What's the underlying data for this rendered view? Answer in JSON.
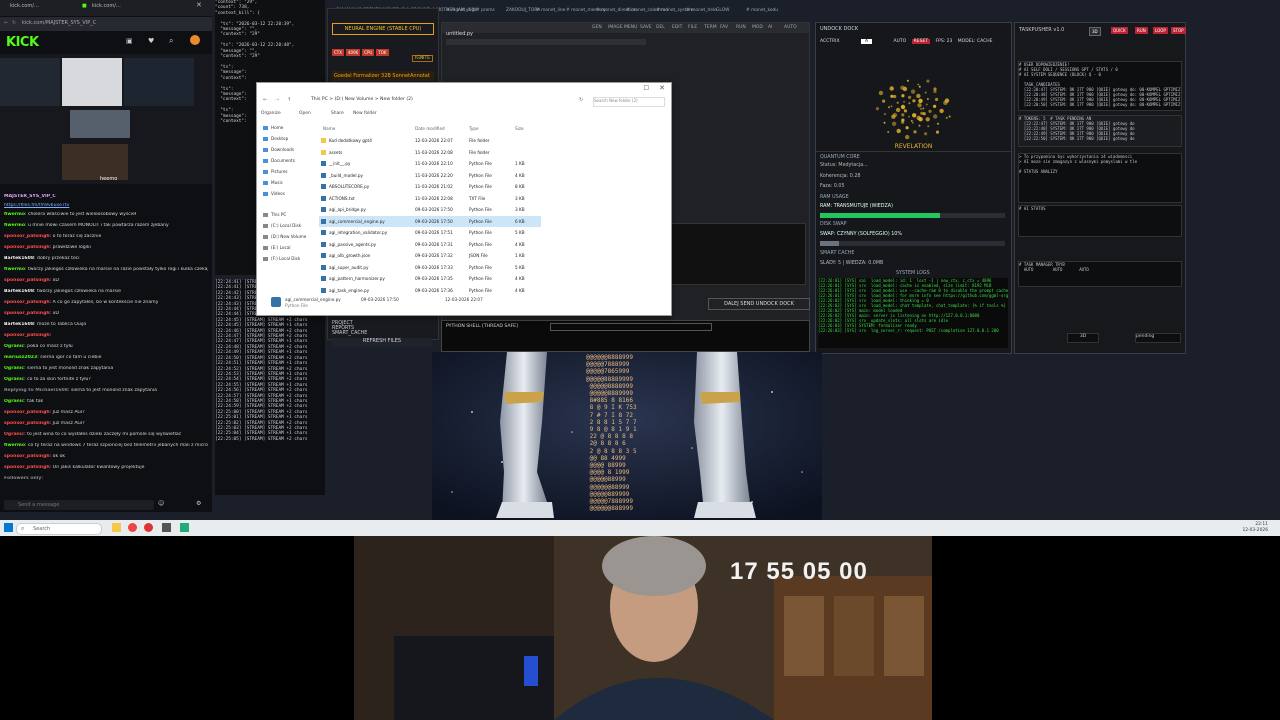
{
  "browser": {
    "tabs": [
      "kick.com/…",
      "Task System Messages",
      "AI stream log"
    ],
    "url": "kick.com/MAJSTER_SYS_VIP_C",
    "brand": "KICK",
    "streamer_label": "heemo",
    "link": "https://files.fm/f/h9vbuxe7tv",
    "chat": [
      {
        "user": "MAJSTER_SYS_VIP_C",
        "text": "",
        "color": "#e0a0ff"
      },
      {
        "user": "fiwermo",
        "text": "cholera właściwie to jest wieloosobowy wyścieł",
        "color": "#53fc18"
      },
      {
        "user": "fiwermo",
        "text": "u mnie mówi czasem MONOLIT i tak powtarza razem zjebany",
        "color": "#53fc18"
      },
      {
        "user": "sponsor_patsingh",
        "text": "o to teraz się zacznie",
        "color": "#ff4d4d"
      },
      {
        "user": "sponsor_patsingh",
        "text": "prawdziwe logiki",
        "color": "#ff4d4d"
      },
      {
        "user": "Bartek1608",
        "text": "dobry przekaz toci",
        "color": "#f0f0f0"
      },
      {
        "user": "fiwermo",
        "text": "twórzy jakiegoś człowieka na marsie na razie powstały tylko rogi i kulka czekajmy dalej",
        "color": "#53fc18"
      },
      {
        "user": "sponsor_patsingh",
        "text": "xD",
        "color": "#ff4d4d"
      },
      {
        "user": "Bartek1608",
        "text": "twórzy jakiegoś człowieka na marsie",
        "color": "#f0f0f0"
      },
      {
        "user": "sponsor_patsingh",
        "text": "A co go zapytałeś, bo w kontekście nie znamy",
        "color": "#ff4d4d"
      },
      {
        "user": "sponsor_patsingh",
        "text": "xD",
        "color": "#ff4d4d"
      },
      {
        "user": "Bartek1608",
        "text": "może to Tablica Ouija",
        "color": "#f0f0f0"
      },
      {
        "user": "sponsor_patsingh",
        "text": "",
        "color": "#ff4d4d"
      },
      {
        "user": "Ogranic",
        "text": "poka co masz z tyłu",
        "color": "#53fc18"
      },
      {
        "user": "mariusz2023",
        "text": "sierna igor co tam u ciebie",
        "color": "#53fc18"
      },
      {
        "user": "Ogranic",
        "text": "sierna to jest monolid znak zapytania",
        "color": "#53fc18"
      },
      {
        "user": "Ogranic",
        "text": "co to za skin fortnite z tyłu?",
        "color": "#53fc18"
      },
      {
        "user": "Replying to Michael1608",
        "text": "sierna to jest monolid znak zapytania",
        "color": "#888888"
      },
      {
        "user": "Ogranic",
        "text": "tak tak",
        "color": "#53fc18"
      },
      {
        "user": "sponsor_patsingh",
        "text": "Już masz AGI?",
        "color": "#ff4d4d"
      },
      {
        "user": "sponsor_patsingh",
        "text": "Już masz AGI?",
        "color": "#ff4d4d"
      },
      {
        "user": "Ogranic",
        "text": "to jest wina to co wysłałes dzieki zaczęły mi pomole się wyświetlać",
        "color": "#ff4d4d"
      },
      {
        "user": "fiwermo",
        "text": "co ty teraz na windows 7 teraz szpionciej bez telemetrii jebanych mali z microsoftu?",
        "color": "#53fc18"
      },
      {
        "user": "sponsor_patsingh",
        "text": "ok ok",
        "color": "#ff4d4d"
      },
      {
        "user": "sponsor_patsingh",
        "text": "On jakiś kalkulator kwantowy projektuje",
        "color": "#ff4d4d"
      },
      {
        "user": "Followers only",
        "text": "",
        "color": "#888888"
      }
    ],
    "chat_placeholder": "Send a message"
  },
  "json_log": "\"context\": \"29\",\n\"count\": 738,\n\"context_kill\": {\n\n  \"ts\": \"2026-03-12 22:20:39\",\n  \"message\": \"\",\n  \"context\": \"29\"\n\n  \"ts\": \"2026-03-12 22:20:48\",\n  \"message\": \"\",\n  \"context\": \"29\"\n\n  \"ts\":\n  \"message\":\n  \"context\":\n\n  \"ts\":\n  \"message\":\n  \"context\":\n\n  \"ts\":\n  \"message\":\n  \"context\":",
  "stream_log": "[22:24:41] [STREAM] STREAM +1 chars\n[22:24:41] [STREAM] STREAM +1 chars\n[22:24:42] [STREAM] STREAM +2 chars\n[22:24:43] [STREAM] STREAM +1 chars\n[22:24:43] [STREAM] STREAM +1 chars\n[22:24:44] [STREAM] STREAM +2 chars\n[22:24:44] [STREAM] STREAM +1 chars\n[22:24:45] [STREAM] STREAM +2 chars\n[22:24:45] [STREAM] STREAM +1 chars\n[22:24:46] [STREAM] STREAM +2 chars\n[22:24:47] [STREAM] STREAM +2 chars\n[22:24:47] [STREAM] STREAM +1 chars\n[22:24:48] [STREAM] STREAM +2 chars\n[22:24:49] [STREAM] STREAM +1 chars\n[22:24:50] [STREAM] STREAM +2 chars\n[22:24:51] [STREAM] STREAM +1 chars\n[22:24:52] [STREAM] STREAM +2 chars\n[22:24:53] [STREAM] STREAM +1 chars\n[22:24:54] [STREAM] STREAM +2 chars\n[22:24:55] [STREAM] STREAM +1 chars\n[22:24:56] [STREAM] STREAM +2 chars\n[22:24:57] [STREAM] STREAM +2 chars\n[22:24:58] [STREAM] STREAM +1 chars\n[22:24:59] [STREAM] STREAM +2 chars\n[22:25:00] [STREAM] STREAM +2 chars\n[22:25:01] [STREAM] STREAM +1 chars\n[22:25:02] [STREAM] STREAM +2 chars\n[22:25:03] [STREAM] STREAM +2 chars\n[22:25:04] [STREAM] STREAM +1 chars\n[22:25:05] [STREAM] STREAM +2 chars",
  "neural": {
    "header": "NEURAL ENGINE (STABLE CPU)",
    "buttons": [
      "CTX",
      "4096",
      "CPU",
      "TOK"
    ],
    "ignite": "IGNITE",
    "formalizer": "Goedel Formalizer 32B SonnetAnnotat",
    "menu": [
      "PROJECT",
      "REPORTS",
      "SMART_CACHE"
    ],
    "refresh": "REFRESH FILES"
  },
  "top_menu": [
    "OM MANI IS CREMEN MOVED IS A GROUND A MOTHER JAM v600",
    "# monet_logs",
    "# proms",
    "ZAKODUJ_TORA",
    "# monet_line",
    "# monet_memory",
    "# monet_direction",
    "# monet_colormod",
    "# monet_system",
    "# monet_hele",
    "GLOW",
    "# monet_kodu"
  ],
  "editor": {
    "tab": "untitled.py",
    "menu": [
      "GEN",
      "IMAGE",
      "MENU",
      "SAVE",
      "DEL",
      "EDIT",
      "FILE",
      "TERM",
      "FAV",
      "RUN",
      "MOD",
      "AI",
      "AUTO"
    ],
    "shell": "PYTHON SHELL [THREAD SAFE]",
    "dock_button": "DALEJ SEND UNDOCK DOCK"
  },
  "revelation": {
    "title": "UNDOCK DOCK",
    "controls": [
      "ACCTRIX",
      "AUTO",
      "RESET",
      "FPS: 23",
      "MODEL: CACHE"
    ],
    "label": "REVELATION",
    "quantum_core": "QUANTUM CORE",
    "status": "Status: Medytacja...",
    "koherencja": "Koherencja: 0.28",
    "phase": "Faza: 0.05",
    "ram_label": "RAM USAGE",
    "ram_title": "RAM: TRANSMUTUJE (WIEDZA)",
    "ram_level": 0.65,
    "swap_label": "DISK SWAP",
    "swap_title": "SWAP: CZYNNY (SOLFEGGIO) 10%",
    "swap_level": 0.1,
    "cache_label": "SMART CACHE",
    "cache_title": "SLADY: 5 | WIEDZA: 0.0MB",
    "logs_title": "SYSTEM LOGS",
    "logs": "[22:26:01] [SYS] sai  load_model: id: 1  lost -1 | new_ctx, c_ctx = 4096\n[22:26:01] [SYS] srv  load_model: cache is enabled, size limit: 8192 MiB\n[22:26:01] [SYS] srv  load_model: use --cache-ram 0 to disable the prompt cache\n[22:26:01] [SYS] srv  load_model: for more info see https://github.com/ggml-org\n[22:26:02] [SYS] srv  load_model: thinking = 0\n[22:26:02] [SYS] srv  load_model: chat template, chat_template: {% if tools %}\n[22:26:02] [SYS] main: model loaded\n[22:26:02] [SYS] main: server is listening on http://127.0.0.1:8080\n[22:26:02] [SYS] srv  update_slots: all slots are idle\n[22:26:03] [SYS] SYSTEM: formalizer ready\n[22:26:03] [SYS] srv  log_server_r: request: POST /completion 127.0.0.1 200"
  },
  "task": {
    "title": "TASKPUSHER v1.0",
    "chips": [
      "3D",
      "QUICK",
      "RUN",
      "LOOP",
      "STOP"
    ],
    "list1": "# USER DOPOWIEDZENIE!\n# AI SELF DOLI / SESSIONS GPT / STATS / 0\n# AI SYSTEM SEQUENCE (BLOCK) Q - 0\n\n  TASK_CANDIDATES\n  [22:20:47] SYSTEM: OK 17T 900 [QUIE] gotowy do: 00-KOMPEL GPTIMIZ\n  [22:20:48] SYSTEM: OK 17T 900 [QUIE] gotowy do: 00-KOMPEL GPTIMIZ\n  [22:20:49] SYSTEM: OK 17T 900 [QUIE] gotowy do: 00-KOMPEL GPTIMIZ\n  [22:20:50] SYSTEM: OK 17T 900 [QUIE] gotowy do: 00-KOMPEL GPTIMIZ",
    "list2": "# TOKENS: 5  # TASK PENDING AN\n  [22:22:47] SYSTEM: OK 17T 900 [QUIE] gotowy do\n  [22:22:48] SYSTEM: OK 17T 900 [QUIE] gotowy do\n  [22:22:49] SYSTEM: OK 17T 900 [QUIE] gotowy do\n  [22:22:50] SYSTEM: OK 17T 900 [QUIE] gotowy do",
    "list3": "> To przypomina byc wykorzystania z4 wiadomosci\n> AI moze sie zmagazyn z wlasnymi pomyslami w tle\n\n# STATUS ANALIZY\n\n",
    "list4": "# AI STATUS\n\n\n\n",
    "list5": "# TASK MANAGER TRYB\n  AUTO        AUTO       AUTO",
    "pending": "pending"
  },
  "explorer": {
    "path": "This PC  >  (D:) New Volume  >  New folder (2)",
    "search_placeholder": "Search New folder (2)",
    "toolbar": [
      "Organize",
      "Open",
      "Share",
      "New folder"
    ],
    "nav": [
      "Home",
      "Desktop",
      "Downloads",
      "Documents",
      "Pictures",
      "Music",
      "Videos",
      "This PC",
      "(C:) Local Disk",
      "(D:) New Volume",
      "(E:) Local",
      "(F:) Local Disk"
    ],
    "columns": [
      "Name",
      "Date modified",
      "Type",
      "Size"
    ],
    "files": [
      {
        "name": "Kod dodatkowy gpt4",
        "date": "12-03-2026 22:07",
        "type": "File folder",
        "size": ""
      },
      {
        "name": "assets",
        "date": "11-03-2026 22:08",
        "type": "File folder",
        "size": ""
      },
      {
        "name": "__init__.py",
        "date": "11-03-2026 22:10",
        "type": "Python File",
        "size": "1 KB"
      },
      {
        "name": "_build_model.py",
        "date": "11-03-2026 22:20",
        "type": "Python File",
        "size": "4 KB"
      },
      {
        "name": "ABSOLUTECORE.py",
        "date": "11-03-2026 21:02",
        "type": "Python File",
        "size": "8 KB"
      },
      {
        "name": "ACTIONS.txt",
        "date": "11-03-2026 22:08",
        "type": "TXT File",
        "size": "3 KB"
      },
      {
        "name": "agi_api_bridge.py",
        "date": "09-03-2026 17:50",
        "type": "Python File",
        "size": "3 KB"
      },
      {
        "name": "agi_commercial_engine.py",
        "date": "09-03-2026 17:50",
        "type": "Python File",
        "size": "6 KB"
      },
      {
        "name": "agi_integration_validator.py",
        "date": "09-03-2026 17:51",
        "type": "Python File",
        "size": "5 KB"
      },
      {
        "name": "agi_passive_agents.py",
        "date": "09-03-2026 17:31",
        "type": "Python File",
        "size": "4 KB"
      },
      {
        "name": "agi_olb_growth.json",
        "date": "09-03-2026 17:32",
        "type": "JSON File",
        "size": "1 KB"
      },
      {
        "name": "agi_super_audit.py",
        "date": "09-03-2026 17:33",
        "type": "Python File",
        "size": "5 KB"
      },
      {
        "name": "agi_pattern_harmonizer.py",
        "date": "09-03-2026 17:35",
        "type": "Python File",
        "size": "4 KB"
      },
      {
        "name": "agi_task_engine.py",
        "date": "09-03-2026 17:36",
        "type": "Python File",
        "size": "4 KB"
      }
    ],
    "selected_index": 7,
    "footer_name": "agi_commercial_engine.py",
    "footer_modified": "09-03-2026 17:50",
    "footer_created": "12-03-2026 22:07",
    "footer_type": "Python File"
  },
  "taskbar": {
    "search": "Search",
    "time": "22:11",
    "date": "12-03-2026"
  },
  "digits": "@@@@@@8888999\n@@@@@7888999\n@@@@@7865999\n@@@@@88889999\n @@@@@8888999\n @@@@@8889999\n 8#885 8 8166\n 8 @ 9 I K 753\n 7 # 7 I 8 72\n 2 8 8 1 5 7 7\n 9 8 @ 8 1 9 1\n 22 @ 8 8 8 8\n 2@ 8 8 8 6\n 2 @ 8 8 8 3 5\n @@ 88 4999\n @@@@ 88999\n @@@@ 8 1999\n @@@@@88999\n @@@@@@88999\n @@@@@889999\n @@@@@7888999\n @@@@@@888999",
  "webcam": {
    "timestamp": "17 55 05 00"
  },
  "colors": {
    "kick_green": "#53fc18",
    "revelation_gold": "#e9b82c",
    "ram_bar": "#22c55e",
    "swap_bar": "#6b7280",
    "log_green": "#3ddc4a"
  }
}
